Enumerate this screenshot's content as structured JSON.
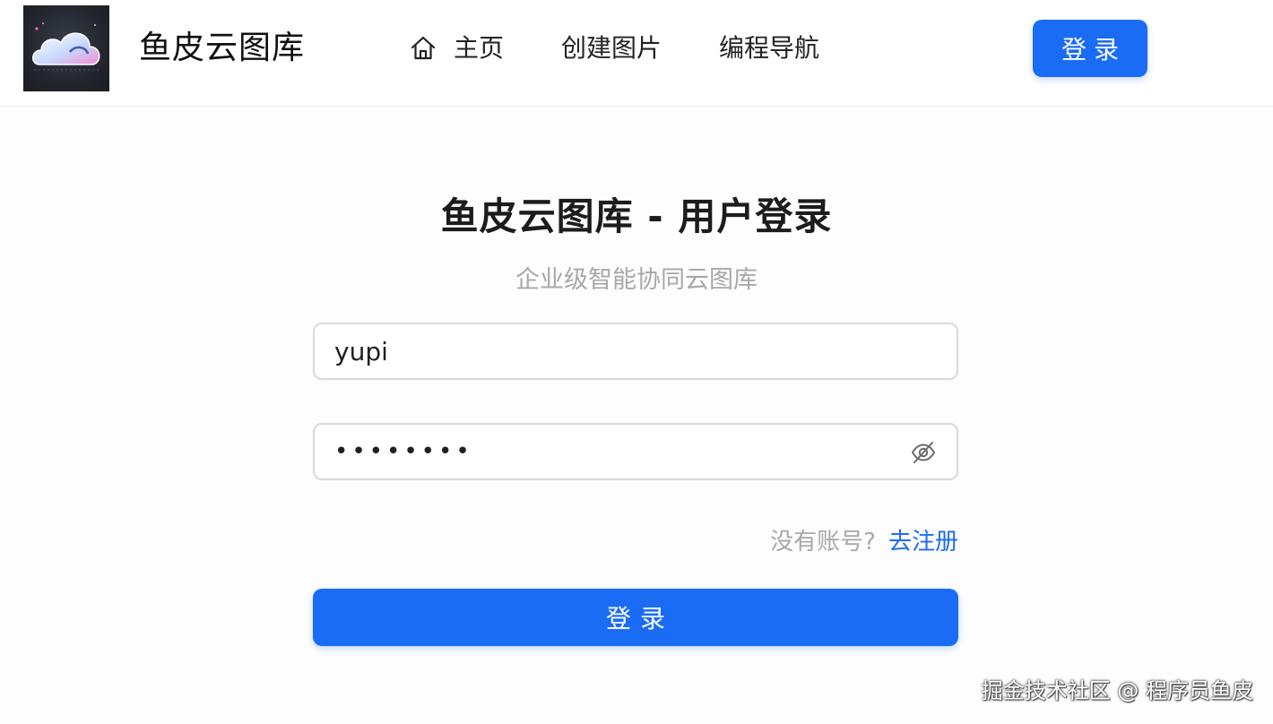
{
  "header": {
    "site_title": "鱼皮云图库",
    "nav": [
      {
        "label": "主页",
        "icon": "home-icon",
        "selected": true
      },
      {
        "label": "创建图片"
      },
      {
        "label": "编程导航"
      }
    ],
    "login_button": "登录"
  },
  "login_form": {
    "title": "鱼皮云图库 - 用户登录",
    "subtitle": "企业级智能协同云图库",
    "username_value": "yupi",
    "password_value": "••••••••",
    "password_toggle_icon": "eye-invisible-icon",
    "register_hint": "没有账号?",
    "register_link": "去注册",
    "submit_button": "登录"
  },
  "watermark": "掘金技术社区 @ 程序员鱼皮",
  "colors": {
    "primary": "#1a6cf5",
    "muted_text": "#a8a8a8",
    "border": "#d9d9d9"
  }
}
